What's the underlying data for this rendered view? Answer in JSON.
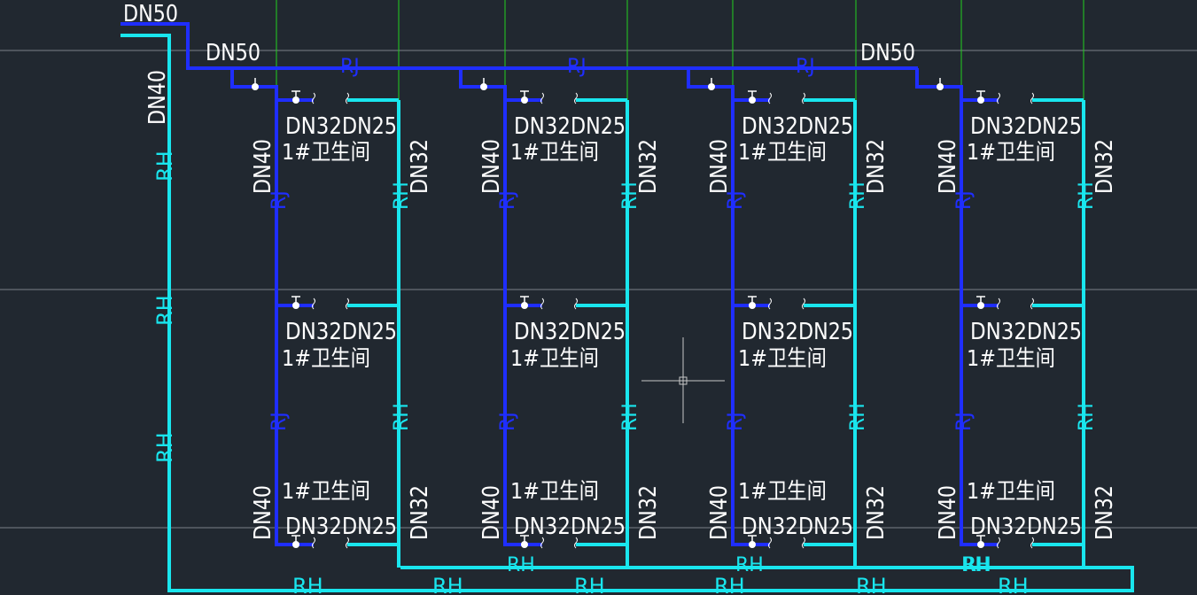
{
  "drawing": {
    "top_main_pipe_label": "DN50",
    "supply_header_label_left": "DN50",
    "supply_header_label_right": "DN50",
    "riser_left_label": "DN40",
    "header_line_code": "RJ",
    "return_line_code": "RH",
    "colors": {
      "background": "#212830",
      "supply_line": "#1f2eff",
      "return_line": "#19e6ee",
      "text": "#ffffff",
      "axis_line": "#23d01f",
      "grid_line": "#7a7f87",
      "cursor": "#c8c8c8"
    },
    "columns": [
      {
        "id": "A"
      },
      {
        "id": "B"
      },
      {
        "id": "C"
      },
      {
        "id": "D"
      }
    ],
    "unit_labels": {
      "riser_dn": "DN40",
      "return_dn": "DN32",
      "branch_supply": "DN32",
      "branch_return": "DN25",
      "room_name": "1#卫生间"
    }
  }
}
